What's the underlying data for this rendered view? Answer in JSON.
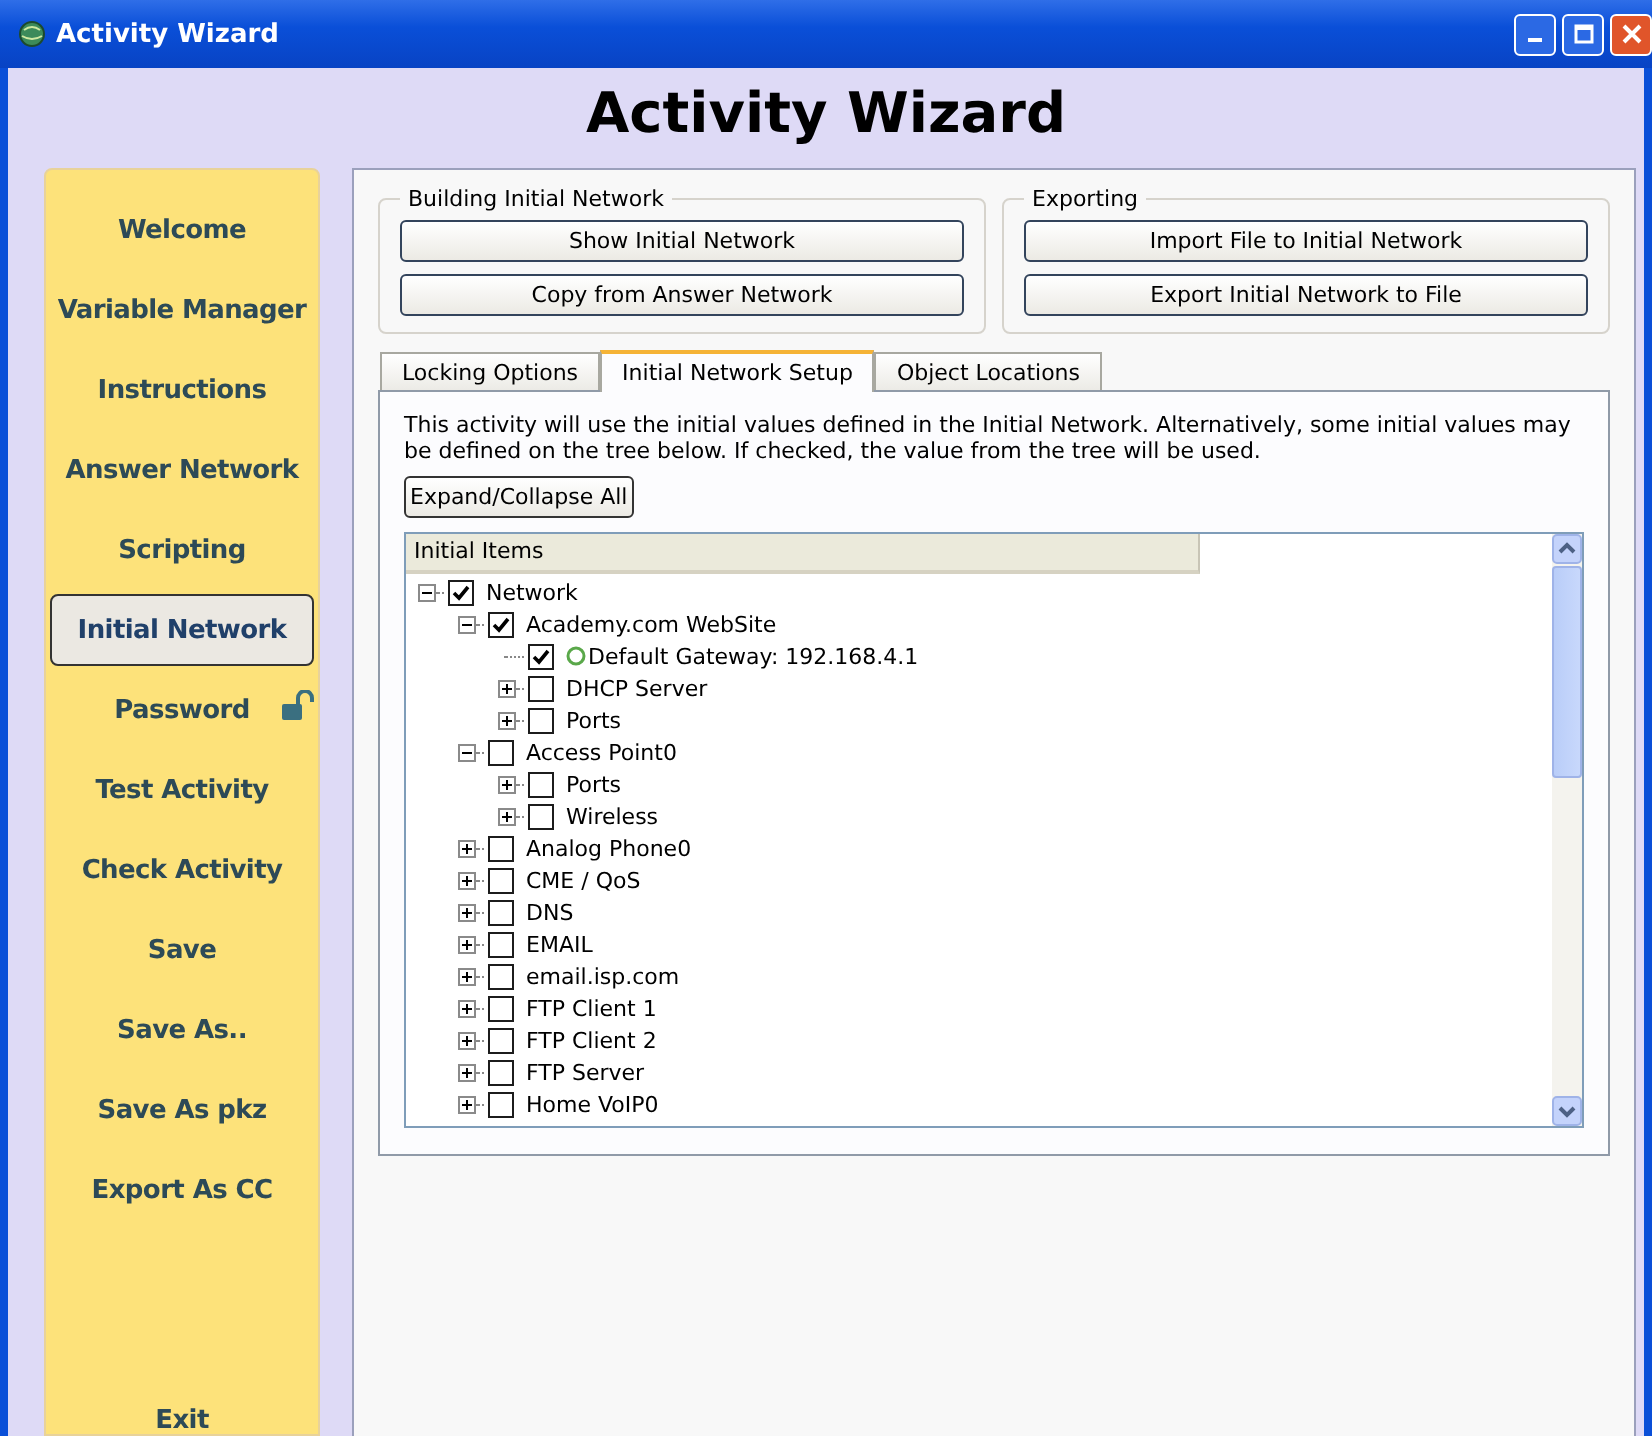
{
  "window": {
    "title": "Activity Wizard"
  },
  "heading": "Activity Wizard",
  "sidebar": {
    "items": [
      {
        "label": "Welcome",
        "selected": false
      },
      {
        "label": "Variable Manager",
        "selected": false
      },
      {
        "label": "Instructions",
        "selected": false
      },
      {
        "label": "Answer Network",
        "selected": false
      },
      {
        "label": "Scripting",
        "selected": false
      },
      {
        "label": "Initial Network",
        "selected": true
      },
      {
        "label": "Password",
        "selected": false,
        "locked": false
      },
      {
        "label": "Test Activity",
        "selected": false
      },
      {
        "label": "Check Activity",
        "selected": false
      },
      {
        "label": "Save",
        "selected": false
      },
      {
        "label": "Save As..",
        "selected": false
      },
      {
        "label": "Save As pkz",
        "selected": false
      },
      {
        "label": "Export As CC",
        "selected": false
      }
    ],
    "exit": "Exit"
  },
  "groups": [
    {
      "title": "Building Initial Network",
      "buttons": [
        "Show Initial Network",
        "Copy from Answer Network"
      ]
    },
    {
      "title": "Exporting",
      "buttons": [
        "Import File to Initial Network",
        "Export Initial Network to File"
      ]
    }
  ],
  "tabs": [
    {
      "label": "Locking Options",
      "selected": false
    },
    {
      "label": "Initial Network Setup",
      "selected": true
    },
    {
      "label": "Object Locations",
      "selected": false
    }
  ],
  "description": "This activity will use the initial values defined in the Initial Network. Alternatively, some initial values may be defined on the tree below. If checked, the value from the tree will be used.",
  "expand_button": "Expand/Collapse All",
  "tree": {
    "column": "Initial Items",
    "items": [
      {
        "label": "Network",
        "kind": "group",
        "checked": true,
        "expanded": true,
        "children": [
          {
            "label": "Academy.com WebSite",
            "kind": "group",
            "checked": true,
            "expanded": true,
            "children": [
              {
                "label": "Default Gateway: 192.168.4.1",
                "kind": "value",
                "checked": true
              },
              {
                "label": "DHCP Server",
                "kind": "group",
                "checked": false,
                "expanded": false
              },
              {
                "label": "Ports",
                "kind": "group",
                "checked": false,
                "expanded": false
              }
            ]
          },
          {
            "label": "Access Point0",
            "kind": "group",
            "checked": false,
            "expanded": true,
            "children": [
              {
                "label": "Ports",
                "kind": "group",
                "checked": false,
                "expanded": false
              },
              {
                "label": "Wireless",
                "kind": "group",
                "checked": false,
                "expanded": false
              }
            ]
          },
          {
            "label": "Analog Phone0",
            "kind": "group",
            "checked": false,
            "expanded": false
          },
          {
            "label": "CME / QoS",
            "kind": "group",
            "checked": false,
            "expanded": false
          },
          {
            "label": "DNS",
            "kind": "group",
            "checked": false,
            "expanded": false
          },
          {
            "label": "EMAIL",
            "kind": "group",
            "checked": false,
            "expanded": false
          },
          {
            "label": "email.isp.com",
            "kind": "group",
            "checked": false,
            "expanded": false
          },
          {
            "label": "FTP Client 1",
            "kind": "group",
            "checked": false,
            "expanded": false
          },
          {
            "label": "FTP Client 2",
            "kind": "group",
            "checked": false,
            "expanded": false
          },
          {
            "label": "FTP Server",
            "kind": "group",
            "checked": false,
            "expanded": false
          },
          {
            "label": "Home VoIP0",
            "kind": "group",
            "checked": false,
            "expanded": false
          }
        ]
      }
    ]
  }
}
